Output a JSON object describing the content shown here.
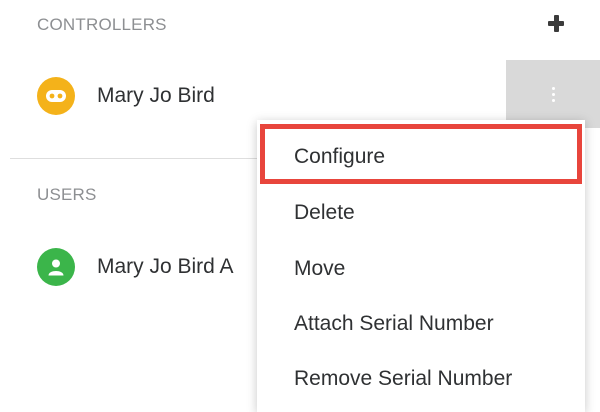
{
  "controllers": {
    "section_title": "CONTROLLERS",
    "add_icon": "plus-icon",
    "items": [
      {
        "name": "Mary Jo Bird",
        "icon": "gamepad-icon",
        "avatar_color": "#f4b21a"
      }
    ]
  },
  "users": {
    "section_title": "USERS",
    "items": [
      {
        "name": "Mary Jo Bird A",
        "icon": "user-icon",
        "avatar_color": "#3bb54a"
      }
    ]
  },
  "context_menu": {
    "trigger_icon": "kebab-menu-icon",
    "highlighted_item_index": 0,
    "highlight_color": "#e8453c",
    "items": [
      {
        "label": "Configure"
      },
      {
        "label": "Delete"
      },
      {
        "label": "Move"
      },
      {
        "label": "Attach Serial Number"
      },
      {
        "label": "Remove Serial Number"
      }
    ]
  }
}
